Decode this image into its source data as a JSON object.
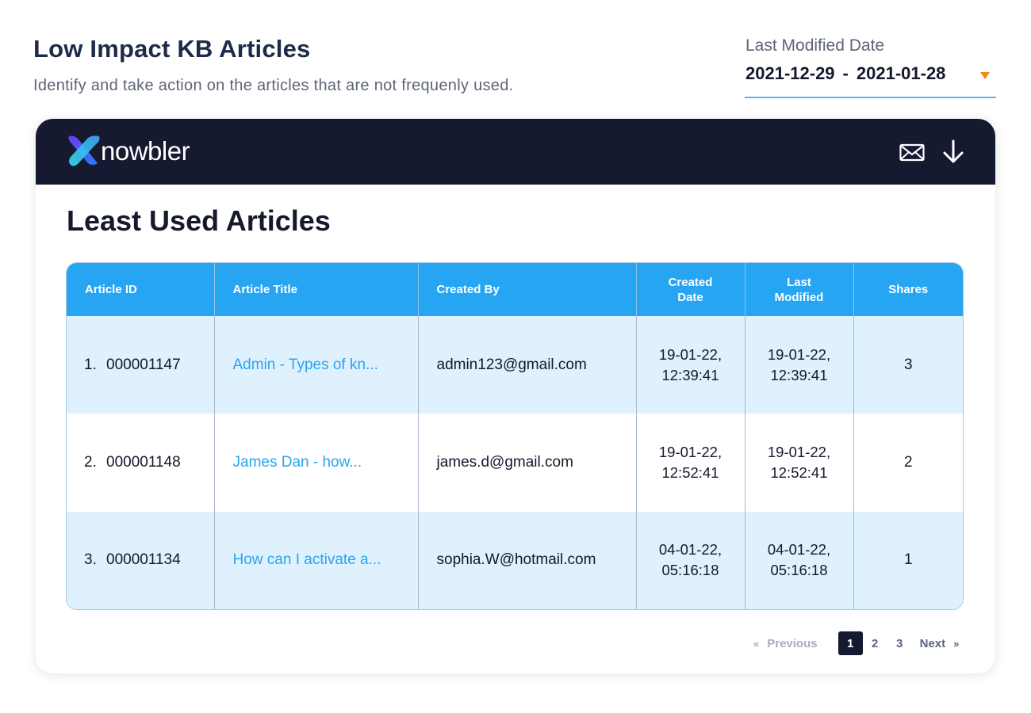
{
  "header": {
    "title": "Low Impact KB Articles",
    "subtitle": "Identify and take action on the articles that are not frequenly used."
  },
  "date_filter": {
    "label": "Last Modified Date",
    "start": "2021-12-29",
    "separator": "-",
    "end": "2021-01-28"
  },
  "card": {
    "brand": "nowbler",
    "section_title": "Least Used Articles",
    "icons": {
      "mail": "mail-icon",
      "download": "download-icon"
    }
  },
  "table": {
    "columns": {
      "id": "Article ID",
      "title": "Article Title",
      "created_by": "Created By",
      "created_date": "Created Date",
      "last_modified": "Last Modified",
      "shares": "Shares"
    },
    "rows": [
      {
        "num": "1.",
        "id": "000001147",
        "title": "Admin - Types of kn...",
        "created_by": "admin123@gmail.com",
        "created_date_1": "19-01-22,",
        "created_date_2": "12:39:41",
        "modified_1": "19-01-22,",
        "modified_2": "12:39:41",
        "shares": "3"
      },
      {
        "num": "2.",
        "id": "000001148",
        "title": "James Dan - how...",
        "created_by": "james.d@gmail.com",
        "created_date_1": "19-01-22,",
        "created_date_2": "12:52:41",
        "modified_1": "19-01-22,",
        "modified_2": "12:52:41",
        "shares": "2"
      },
      {
        "num": "3.",
        "id": "000001134",
        "title": "How can I activate a...",
        "created_by": "sophia.W@hotmail.com",
        "created_date_1": "04-01-22,",
        "created_date_2": "05:16:18",
        "modified_1": "04-01-22,",
        "modified_2": "05:16:18",
        "shares": "1"
      }
    ]
  },
  "pagination": {
    "prev_chevron": "«",
    "prev": "Previous",
    "pages": [
      "1",
      "2",
      "3"
    ],
    "active_page": "1",
    "next": "Next",
    "next_chevron": "»"
  },
  "colors": {
    "header_bar": "#151a30",
    "table_header": "#26a5f3",
    "row_alt": "#def1fd",
    "link": "#2aa4f0",
    "caret": "#f08a12",
    "underline": "#5fb3f0"
  }
}
